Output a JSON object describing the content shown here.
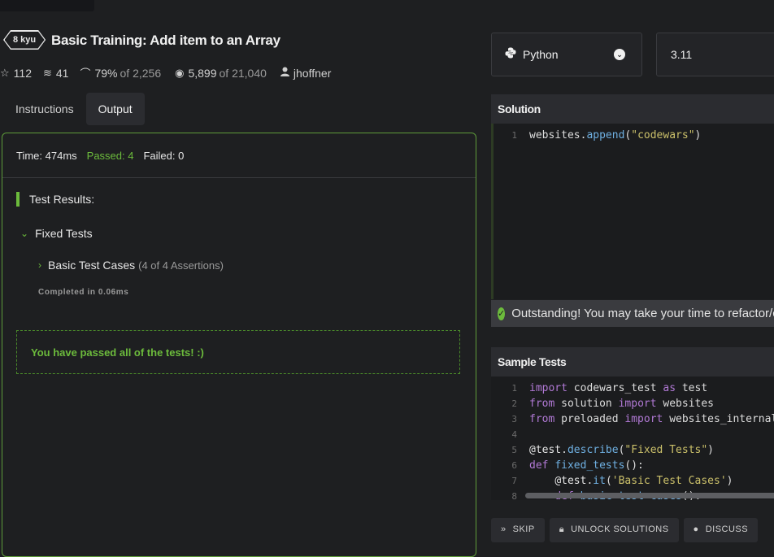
{
  "kata": {
    "rank": "8 kyu",
    "title": "Basic Training: Add item to an Array"
  },
  "stats": {
    "stars": "112",
    "collections": "41",
    "satisfaction_pct": "79%",
    "satisfaction_of": "of 2,256",
    "completed": "5,899",
    "completed_of": "of 21,040",
    "author": "jhoffner"
  },
  "tabs": [
    {
      "label": "Instructions"
    },
    {
      "label": "Output"
    }
  ],
  "output": {
    "time": "Time: 474ms",
    "passed": "Passed: 4",
    "failed": "Failed: 0",
    "results_heading": "Test Results:",
    "fixed_tests": "Fixed Tests",
    "basic_cases": "Basic Test Cases",
    "assertions": "(4 of 4 Assertions)",
    "completed": "Completed in 0.06ms",
    "pass_message": "You have passed all of the tests! :)"
  },
  "language": {
    "name": "Python",
    "version": "3.11"
  },
  "solution": {
    "heading": "Solution",
    "line_numbers": [
      "1"
    ],
    "banner": "Outstanding! You may take your time to refactor/comment your solution."
  },
  "sample_tests": {
    "heading": "Sample Tests",
    "line_numbers": [
      "1",
      "2",
      "3",
      "4",
      "5",
      "6",
      "7",
      "8"
    ]
  },
  "buttons": {
    "skip": "SKIP",
    "unlock": "UNLOCK SOLUTIONS",
    "discuss": "DISCUSS"
  },
  "colors": {
    "accent_green": "#6cbb3c",
    "background": "#1e1f21"
  },
  "icons": {
    "star": "star-icon",
    "collections": "layers-icon",
    "satisfaction": "rainbow-icon",
    "completed": "target-icon",
    "author": "user-icon",
    "python": "python-icon",
    "check": "check-circle-icon"
  }
}
